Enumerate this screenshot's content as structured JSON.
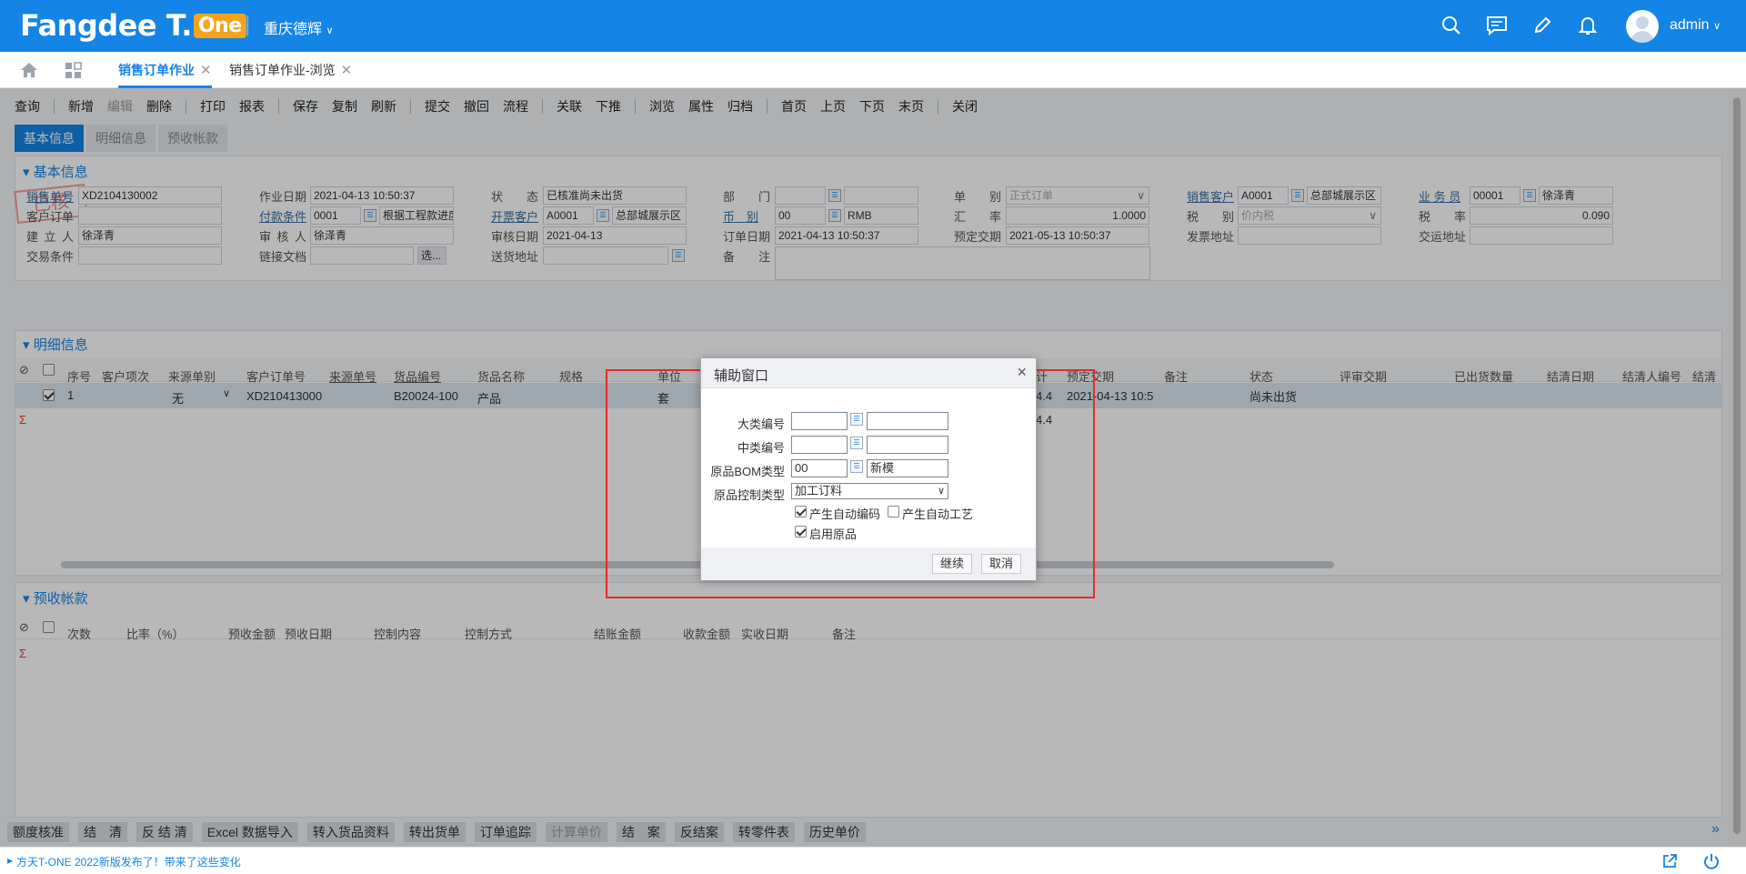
{
  "header": {
    "logo_text": "Fangdee T.",
    "logo_badge": "One",
    "company": "重庆德辉",
    "user": "admin",
    "icons": [
      "search-icon",
      "message-icon",
      "edit-icon",
      "bell-icon",
      "avatar-icon"
    ]
  },
  "tabs": [
    {
      "label": "销售订单作业"
    },
    {
      "label": "销售订单作业-浏览"
    }
  ],
  "toolbar": {
    "groups": [
      [
        "查询"
      ],
      [
        "新增",
        "编辑",
        "删除"
      ],
      [
        "打印",
        "报表"
      ],
      [
        "保存",
        "复制",
        "刷新"
      ],
      [
        "提交",
        "撤回",
        "流程"
      ],
      [
        "关联",
        "下推"
      ],
      [
        "浏览",
        "属性",
        "归档"
      ],
      [
        "首页",
        "上页",
        "下页",
        "末页"
      ],
      [
        "关闭"
      ]
    ],
    "disabled": [
      "编辑"
    ]
  },
  "subtabs": [
    "基本信息",
    "明细信息",
    "预收帐款"
  ],
  "basic": {
    "title": "▾ 基本信息",
    "stamp": "已核",
    "fields": {
      "order_no_label": "销售单号",
      "order_no": "XD2104130002",
      "cust_order_label": "客户订单",
      "cust_order": "",
      "creator_label": "建 立 人",
      "creator": "徐泽青",
      "trade_label": "交易条件",
      "trade": "",
      "work_date_label": "作业日期",
      "work_date": "2021-04-13 10:50:37",
      "pay_label": "付款条件",
      "pay_code": "0001",
      "pay_name": "根据工程款进度",
      "reviewer_label": "审 核 人",
      "reviewer": "徐泽青",
      "link_label": "链接文档",
      "link_btn": "选...",
      "status_label": "状　态",
      "status": "已核准尚未出货",
      "invoice_cust_label": "开票客户",
      "invoice_cust_code": "A0001",
      "invoice_cust_name": "总部城展示区",
      "review_date_label": "审核日期",
      "review_date": "2021-04-13",
      "ship_addr_label": "送货地址",
      "ship_addr": "",
      "dept_label": "部　门",
      "dept_code": "",
      "dept_name": "",
      "currency_label": "币　别",
      "currency_code": "00",
      "currency_name": "RMB",
      "order_date_label": "订单日期",
      "order_date": "2021-04-13 10:50:37",
      "remark_label": "备　注",
      "remark": "",
      "doc_type_label": "单　别",
      "doc_type": "正式订单",
      "rate_label": "汇　率",
      "rate": "1.0000",
      "delivery_label": "预定交期",
      "delivery": "2021-05-13 10:50:37",
      "sales_cust_label": "销售客户",
      "sales_cust_code": "A0001",
      "sales_cust_name": "总部城展示区",
      "tax_type_label": "税　别",
      "tax_type": "价内税",
      "inv_addr_label": "发票地址",
      "inv_addr": "",
      "salesman_label": "业 务 员",
      "salesman_code": "00001",
      "salesman_name": "徐泽青",
      "tax_rate_label": "税　率",
      "tax_rate": "0.090",
      "deliv_addr_label": "交运地址",
      "deliv_addr": ""
    }
  },
  "detail": {
    "title": "▾ 明细信息",
    "columns": [
      "序号",
      "客户项次",
      "来源单别",
      "客户订单号",
      "来源单号",
      "货品编号",
      "货品名称",
      "规格",
      "单位",
      "计",
      "预定交期",
      "备注",
      "状态",
      "评审交期",
      "已出货数量",
      "结清日期",
      "结清人编号",
      "结清"
    ],
    "row": {
      "seq": "1",
      "src_type": "无",
      "cust_order_no": "XD210413000",
      "item_no": "B20024-100",
      "item_name": "产品",
      "unit": "套",
      "amount": "4.4",
      "delivery": "2021-04-13 10:5",
      "status": "尚未出货"
    },
    "sum_amount": "4.4",
    "sigma": "Σ"
  },
  "prepay": {
    "title": "▾ 预收帐款",
    "columns": [
      "次数",
      "比率（%）",
      "预收金额",
      "预收日期",
      "控制内容",
      "控制方式",
      "结账金额",
      "收款金额",
      "实收日期",
      "备注"
    ],
    "sigma": "Σ"
  },
  "bottom_buttons": [
    "额度核准",
    "结　清",
    "反 结 清",
    "Excel 数据导入",
    "转入货品资料",
    "转出货单",
    "订单追踪",
    "计算单价",
    "结　案",
    "反结案",
    "转零件表",
    "历史单价"
  ],
  "bottom_disabled": [
    "计算单价"
  ],
  "bottom_more": "»",
  "status_text": "方天T-ONE 2022新版发布了！带来了这些变化",
  "dialog": {
    "title": "辅助窗口",
    "close": "×",
    "major_label": "大类编号",
    "major_code": "",
    "major_name": "",
    "middle_label": "中类编号",
    "middle_code": "",
    "middle_name": "",
    "bom_label": "原品BOM类型",
    "bom_code": "00",
    "bom_name": "新模",
    "ctrl_label": "原品控制类型",
    "ctrl_value": "加工订料",
    "auto_code_label": "产生自动编码",
    "auto_code": true,
    "auto_proc_label": "产生自动工艺",
    "auto_proc": false,
    "enable_label": "启用原品",
    "enable": true,
    "ok_label": "继续",
    "cancel_label": "取消"
  },
  "colors": {
    "brand": "#1484e6",
    "logo_badge": "#f7a21b",
    "highlight": "#e52b2b"
  }
}
